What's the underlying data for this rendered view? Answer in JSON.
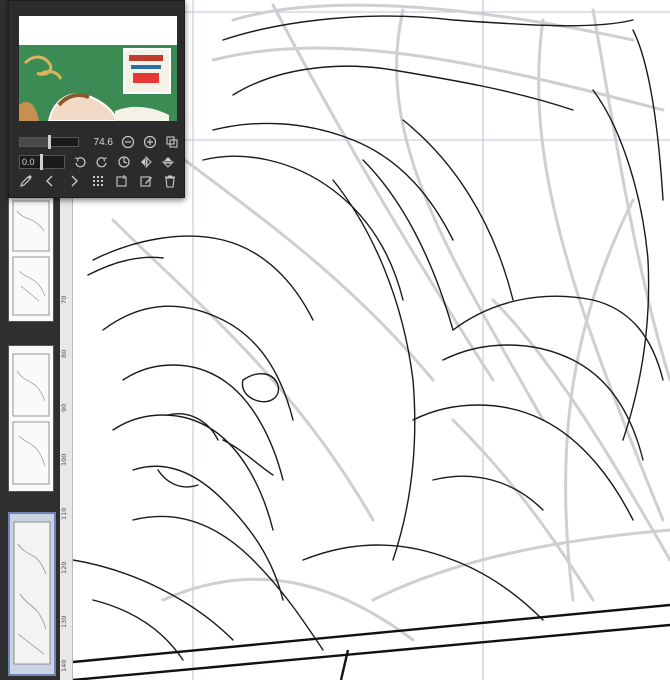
{
  "navigator": {
    "zoom_value": "74.6",
    "rotation_value": "0.0",
    "zoom_level_fraction": 0.5,
    "rotation_fraction": 0.5,
    "icons": [
      "zoom-out-icon",
      "zoom-in-icon",
      "fit-window-icon",
      "rotate-left-icon",
      "rotate-right-icon",
      "reset-rotation-icon",
      "flip-horizontal-icon",
      "flip-vertical-icon",
      "eyedropper-icon",
      "previous-icon",
      "next-icon",
      "grid-icon",
      "new-page-icon",
      "edit-icon",
      "delete-icon"
    ]
  },
  "ruler": {
    "ticks": [
      "70",
      "80",
      "90",
      "100",
      "110",
      "120",
      "130",
      "140"
    ]
  },
  "colors": {
    "panel_bg": "#2b2b2b",
    "canvas_bg": "#ffffff",
    "sketch_dark": "#1a1a1a",
    "sketch_gray": "#c8c8c8",
    "guide_blue": "#a9b3d6",
    "preview_green": "#3c8a54",
    "active_thumb": "#6d86b8"
  }
}
